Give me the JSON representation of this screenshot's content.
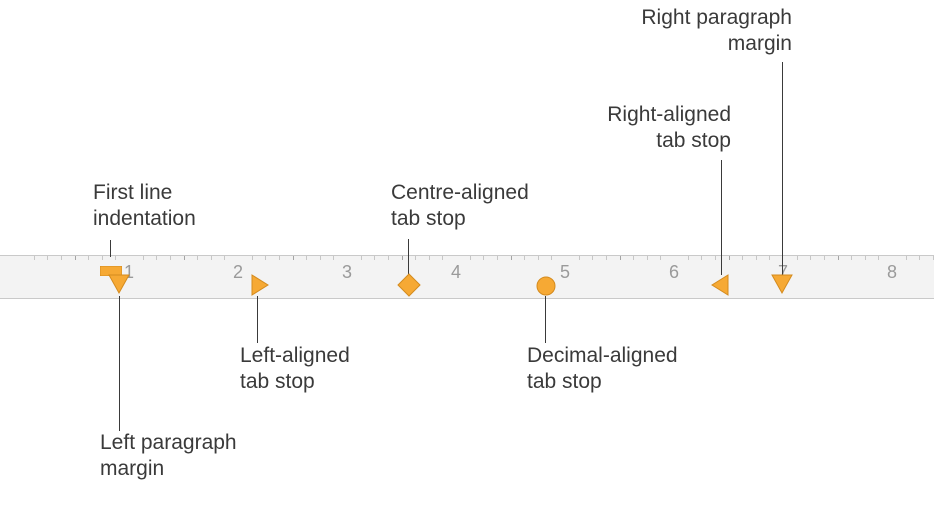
{
  "ruler": {
    "numbers": [
      "1",
      "2",
      "3",
      "4",
      "5",
      "6",
      "7",
      "8"
    ]
  },
  "labels": {
    "first_line_indentation": "First line\nindentation",
    "centre_aligned_tab_stop": "Centre-aligned\ntab stop",
    "right_paragraph_margin": "Right paragraph\nmargin",
    "right_aligned_tab_stop": "Right-aligned\ntab stop",
    "left_aligned_tab_stop": "Left-aligned\ntab stop",
    "decimal_aligned_tab_stop": "Decimal-aligned\ntab stop",
    "left_paragraph_margin": "Left paragraph\nmargin"
  },
  "colors": {
    "marker_fill": "#f6a934",
    "marker_stroke": "#d48b1e",
    "text": "#3a3a3a"
  }
}
